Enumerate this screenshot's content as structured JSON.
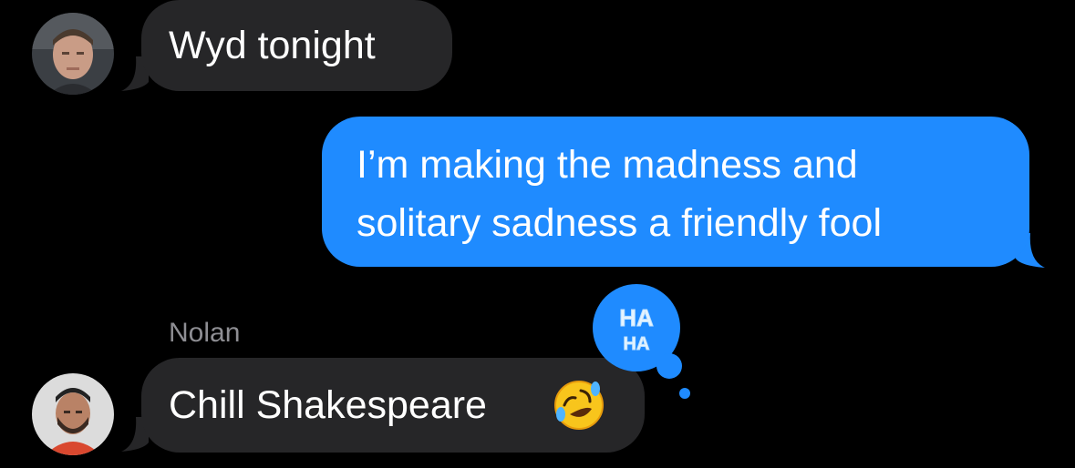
{
  "messages": [
    {
      "direction": "incoming",
      "text": "Wyd tonight"
    },
    {
      "direction": "outgoing",
      "line1": "I’m making the madness and",
      "line2": "solitary sadness a friendly fool"
    },
    {
      "direction": "incoming",
      "sender": "Nolan",
      "text": "Chill Shakespeare",
      "emoji": "🤣",
      "reaction": "HA HA"
    }
  ],
  "reaction_badge": {
    "line1": "HA",
    "line2": "HA"
  },
  "colors": {
    "background": "#000000",
    "incoming_bubble": "#262628",
    "outgoing_bubble": "#1f8bff",
    "sender_name": "#8e8e93"
  }
}
